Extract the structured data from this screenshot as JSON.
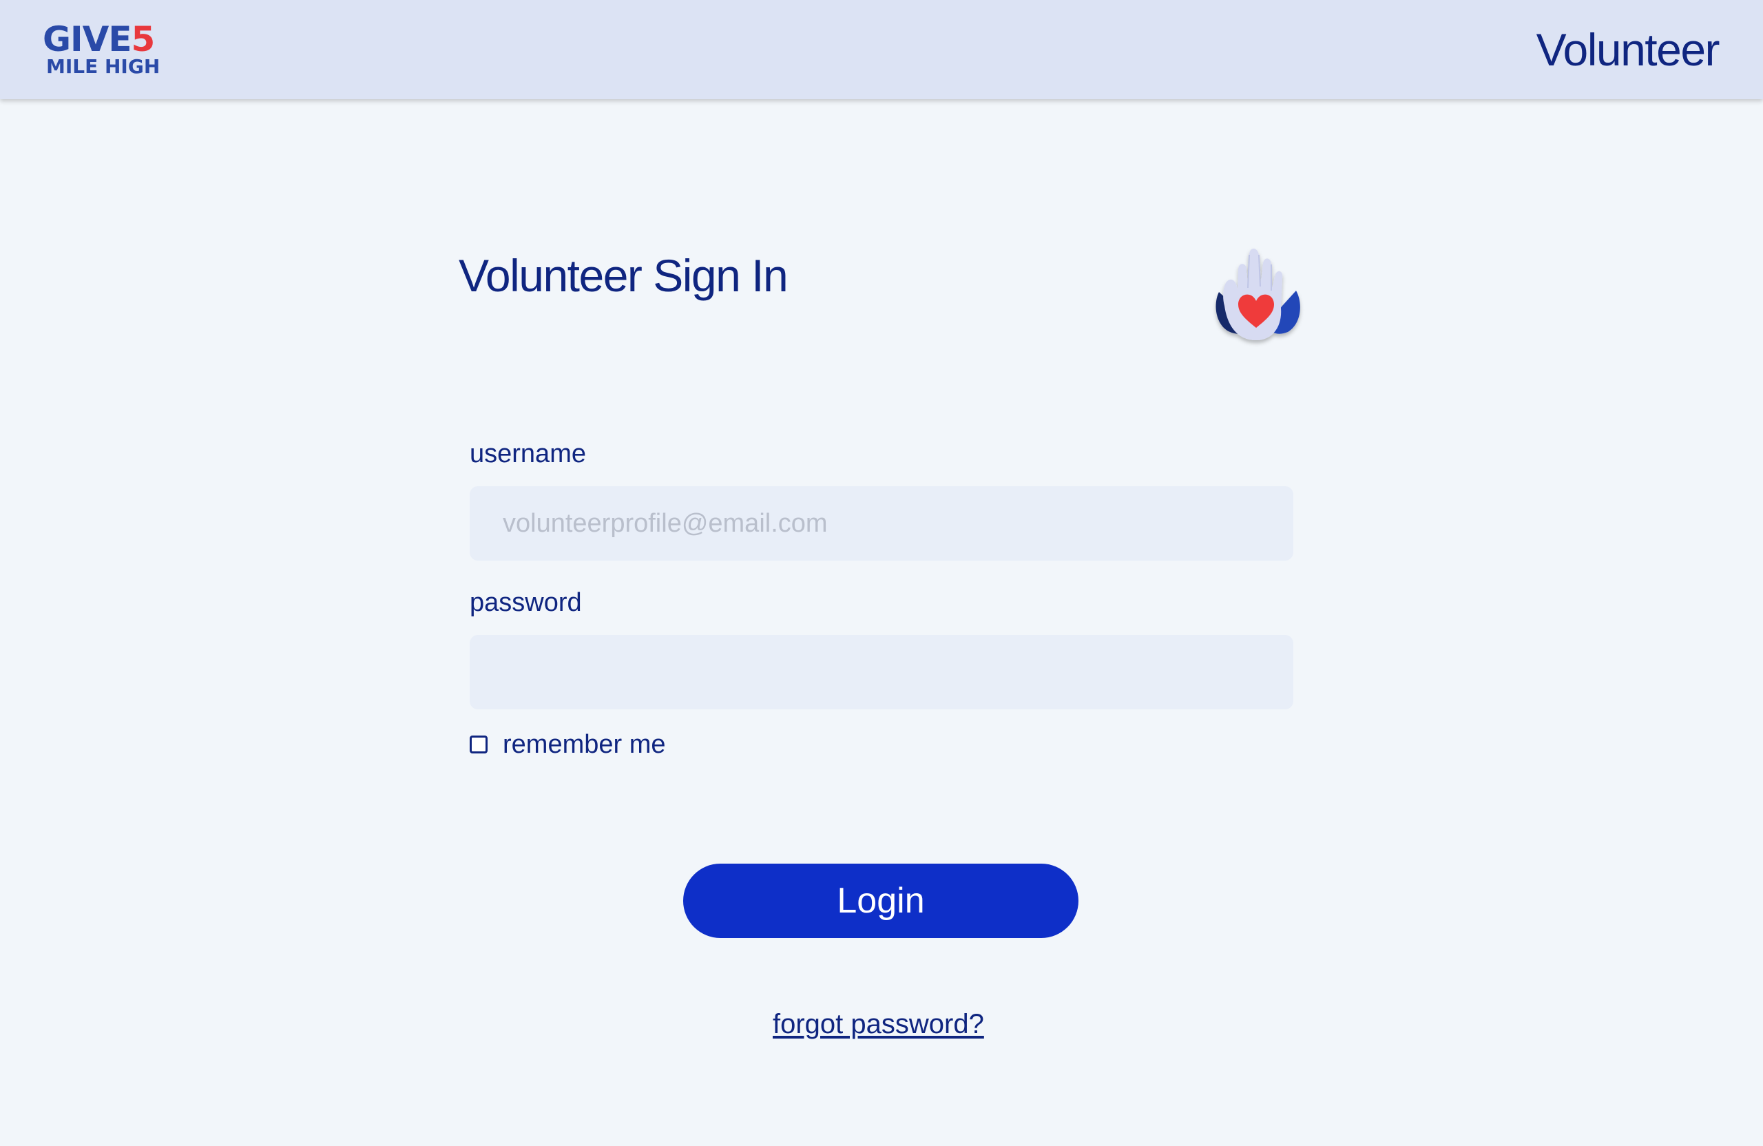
{
  "header": {
    "logo_give": "GIVE",
    "logo_five": "5",
    "logo_sub": "MILE HIGH",
    "title": "Volunteer"
  },
  "main": {
    "title": "Volunteer Sign In",
    "illustration_icon": "hand-with-heart-icon",
    "username": {
      "label": "username",
      "placeholder": "volunteerprofile@email.com",
      "value": ""
    },
    "password": {
      "label": "password",
      "placeholder": "",
      "value": ""
    },
    "remember": {
      "label": "remember me",
      "checked": false
    },
    "login_label": "Login",
    "forgot_label": "forgot password?"
  },
  "colors": {
    "header_bg": "#dce3f4",
    "page_bg": "#f2f6fa",
    "text_primary": "#0f2580",
    "button_bg": "#0e2fc8",
    "logo_blue": "#2a4aa8",
    "logo_red": "#e8383d",
    "input_bg": "#e8eef8"
  }
}
